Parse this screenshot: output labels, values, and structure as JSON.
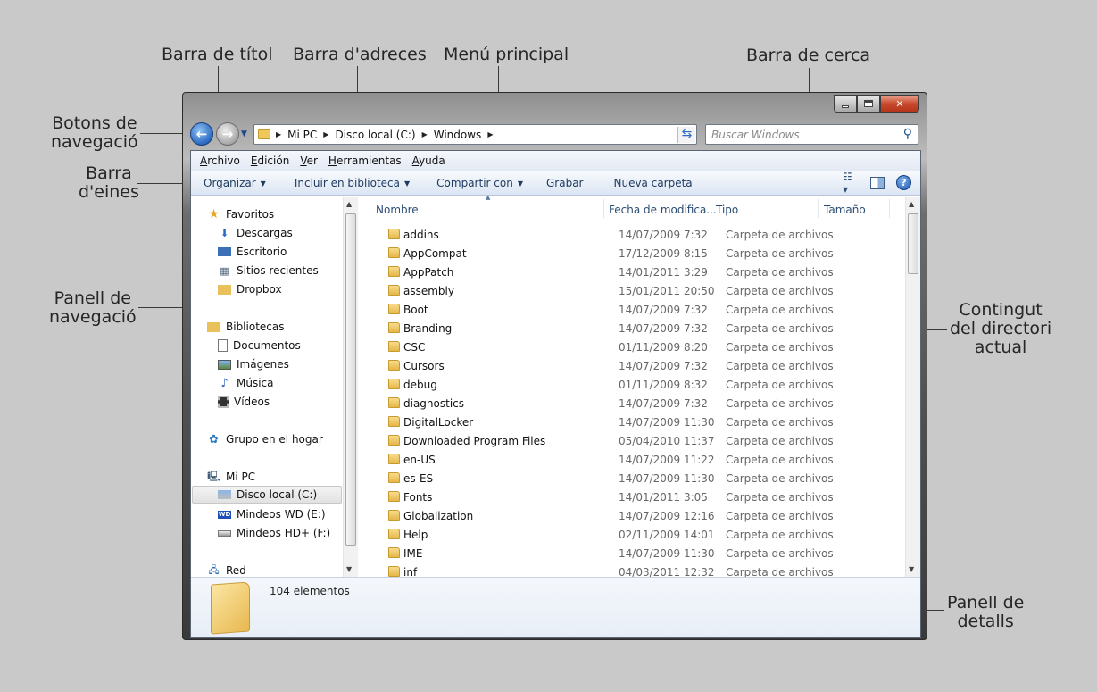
{
  "callouts": {
    "title_bar": "Barra de títol",
    "address_bar": "Barra d'adreces",
    "main_menu": "Menú principal",
    "search_bar": "Barra de cerca",
    "nav_buttons_1": "Botons de",
    "nav_buttons_2": "navegació",
    "toolbar_1": "Barra",
    "toolbar_2": "d'eines",
    "nav_pane_1": "Panell de",
    "nav_pane_2": "navegació",
    "content_1": "Contingut",
    "content_2": "del directori",
    "content_3": "actual",
    "details_1": "Panell de",
    "details_2": "detalls"
  },
  "address": {
    "crumbs": [
      "Mi PC",
      "Disco local (C:)",
      "Windows"
    ]
  },
  "search": {
    "placeholder": "Buscar Windows"
  },
  "menu": [
    "Archivo",
    "Edición",
    "Ver",
    "Herramientas",
    "Ayuda"
  ],
  "toolbar": {
    "organize": "Organizar",
    "include": "Incluir en biblioteca",
    "share": "Compartir con",
    "burn": "Grabar",
    "new_folder": "Nueva carpeta"
  },
  "nav": {
    "favorites": "Favoritos",
    "downloads": "Descargas",
    "desktop": "Escritorio",
    "recent": "Sitios recientes",
    "dropbox": "Dropbox",
    "libraries": "Bibliotecas",
    "documents": "Documentos",
    "images": "Imágenes",
    "music": "Música",
    "videos": "Vídeos",
    "homegroup": "Grupo en el hogar",
    "mypc": "Mi PC",
    "local_disk": "Disco local (C:)",
    "wd": "Mindeos WD (E:)",
    "hd": "Mindeos HD+ (F:)",
    "network": "Red"
  },
  "columns": {
    "name": "Nombre",
    "date": "Fecha de modifica...",
    "type": "Tipo",
    "size": "Tamaño"
  },
  "files": [
    {
      "name": "addins",
      "date": "14/07/2009 7:32",
      "type": "Carpeta de archivos"
    },
    {
      "name": "AppCompat",
      "date": "17/12/2009 8:15",
      "type": "Carpeta de archivos"
    },
    {
      "name": "AppPatch",
      "date": "14/01/2011 3:29",
      "type": "Carpeta de archivos"
    },
    {
      "name": "assembly",
      "date": "15/01/2011 20:50",
      "type": "Carpeta de archivos"
    },
    {
      "name": "Boot",
      "date": "14/07/2009 7:32",
      "type": "Carpeta de archivos"
    },
    {
      "name": "Branding",
      "date": "14/07/2009 7:32",
      "type": "Carpeta de archivos"
    },
    {
      "name": "CSC",
      "date": "01/11/2009 8:20",
      "type": "Carpeta de archivos"
    },
    {
      "name": "Cursors",
      "date": "14/07/2009 7:32",
      "type": "Carpeta de archivos"
    },
    {
      "name": "debug",
      "date": "01/11/2009 8:32",
      "type": "Carpeta de archivos"
    },
    {
      "name": "diagnostics",
      "date": "14/07/2009 7:32",
      "type": "Carpeta de archivos"
    },
    {
      "name": "DigitalLocker",
      "date": "14/07/2009 11:30",
      "type": "Carpeta de archivos"
    },
    {
      "name": "Downloaded Program Files",
      "date": "05/04/2010 11:37",
      "type": "Carpeta de archivos"
    },
    {
      "name": "en-US",
      "date": "14/07/2009 11:22",
      "type": "Carpeta de archivos"
    },
    {
      "name": "es-ES",
      "date": "14/07/2009 11:30",
      "type": "Carpeta de archivos"
    },
    {
      "name": "Fonts",
      "date": "14/01/2011 3:05",
      "type": "Carpeta de archivos"
    },
    {
      "name": "Globalization",
      "date": "14/07/2009 12:16",
      "type": "Carpeta de archivos"
    },
    {
      "name": "Help",
      "date": "02/11/2009 14:01",
      "type": "Carpeta de archivos"
    },
    {
      "name": "IME",
      "date": "14/07/2009 11:30",
      "type": "Carpeta de archivos"
    },
    {
      "name": "inf",
      "date": "04/03/2011 12:32",
      "type": "Carpeta de archivos"
    }
  ],
  "details": {
    "count": "104 elementos"
  }
}
